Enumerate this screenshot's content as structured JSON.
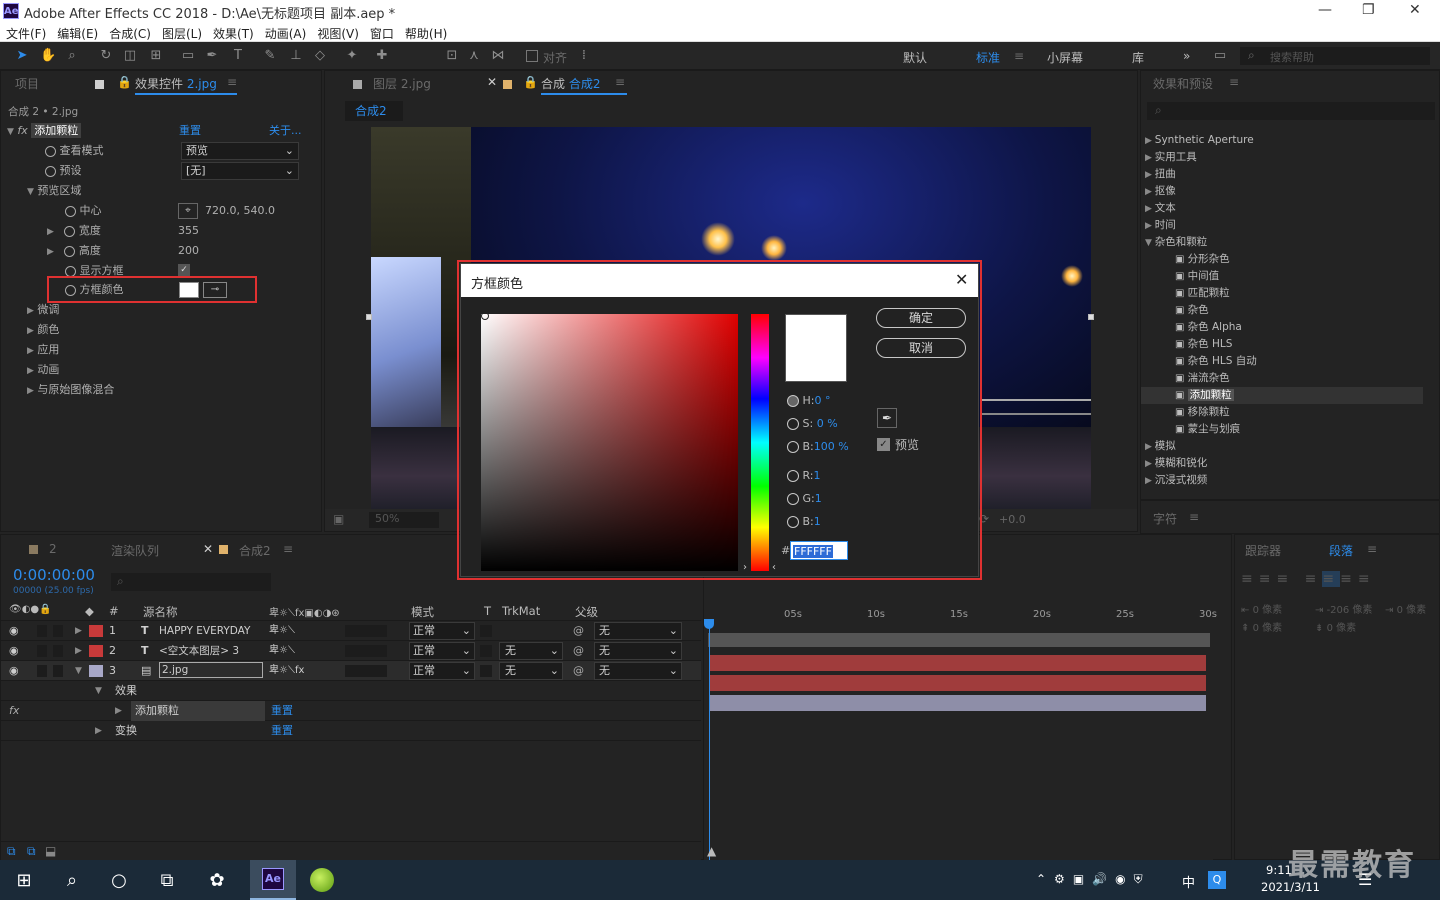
{
  "window": {
    "logo": "Ae",
    "title": "Adobe After Effects CC 2018 - D:\\Ae\\无标题项目 副本.aep *",
    "minimize": "—",
    "maximize": "❐",
    "close": "✕"
  },
  "menu": [
    "文件(F)",
    "编辑(E)",
    "合成(C)",
    "图层(L)",
    "效果(T)",
    "动画(A)",
    "视图(V)",
    "窗口",
    "帮助(H)"
  ],
  "toolbar": {
    "align_label": "对齐",
    "workspaces": [
      "默认",
      "标准",
      "小屏幕",
      "库"
    ],
    "more": "»",
    "search_placeholder": "搜索帮助"
  },
  "left_panel": {
    "tabs": [
      "项目",
      "效果控件 2.jpg"
    ],
    "tab_project": "项目",
    "tab_effect_prefix": "效果控件",
    "tab_effect_file": "2.jpg",
    "source": "合成 2 • 2.jpg",
    "effect": {
      "name": "添加颗粒",
      "reset": "重置",
      "about": "关于..."
    },
    "props": {
      "view_mode": {
        "label": "查看模式",
        "value": "预览"
      },
      "preset": {
        "label": "预设",
        "value": "[无]"
      },
      "preview_region": "预览区域",
      "center": {
        "label": "中心",
        "value": "720.0, 540.0"
      },
      "width": {
        "label": "宽度",
        "value": "355"
      },
      "height": {
        "label": "高度",
        "value": "200"
      },
      "show_box": {
        "label": "显示方框"
      },
      "box_color": {
        "label": "方框颜色"
      }
    },
    "groups": [
      "微调",
      "颜色",
      "应用",
      "动画",
      "与原始图像混合"
    ]
  },
  "viewer": {
    "tab_layer": "图层 2.jpg",
    "tab_comp_prefix": "合成",
    "tab_comp_name": "合成2",
    "breadcrumb": "合成2",
    "zoom": "50%",
    "exposure": "+0.0"
  },
  "effects_panel": {
    "title": "效果和预设",
    "items": [
      {
        "label": "Synthetic Aperture",
        "type": "cat"
      },
      {
        "label": "实用工具",
        "type": "cat"
      },
      {
        "label": "扭曲",
        "type": "cat"
      },
      {
        "label": "抠像",
        "type": "cat"
      },
      {
        "label": "文本",
        "type": "cat"
      },
      {
        "label": "时间",
        "type": "cat"
      },
      {
        "label": "杂色和颗粒",
        "type": "open"
      },
      {
        "label": "分形杂色",
        "type": "fx"
      },
      {
        "label": "中间值",
        "type": "fx"
      },
      {
        "label": "匹配颗粒",
        "type": "fx"
      },
      {
        "label": "杂色",
        "type": "fx"
      },
      {
        "label": "杂色 Alpha",
        "type": "fx"
      },
      {
        "label": "杂色 HLS",
        "type": "fx"
      },
      {
        "label": "杂色 HLS 自动",
        "type": "fx"
      },
      {
        "label": "湍流杂色",
        "type": "fx"
      },
      {
        "label": "添加颗粒",
        "type": "fx-sel"
      },
      {
        "label": "移除颗粒",
        "type": "fx"
      },
      {
        "label": "蒙尘与划痕",
        "type": "fx"
      },
      {
        "label": "模拟",
        "type": "cat"
      },
      {
        "label": "模糊和锐化",
        "type": "cat"
      },
      {
        "label": "沉浸式视频",
        "type": "cat"
      }
    ],
    "char_tab": "字符"
  },
  "right_lower": {
    "tracker": "跟踪器",
    "paragraph": "段落",
    "px0a": "0 像素",
    "px_neg": "-206 像素",
    "px0b": "0 像素",
    "px0c": "0 像素",
    "px0d": "0 像素"
  },
  "timeline": {
    "tabs": [
      "2",
      "渲染队列",
      "合成2"
    ],
    "timecode": "0:00:00:00",
    "fps": "00000 (25.00 fps)",
    "columns": {
      "num": "#",
      "source": "源名称",
      "mode": "模式",
      "t": "T",
      "trkmat": "TrkMat",
      "parent": "父级"
    },
    "layers": [
      {
        "n": "1",
        "icon": "T",
        "name": "HAPPY EVERYDAY",
        "mode": "正常",
        "trk": "",
        "parent": "无",
        "color": "#c83a3a"
      },
      {
        "n": "2",
        "icon": "T",
        "name": "<空文本图层> 3",
        "mode": "正常",
        "trk": "无",
        "parent": "无",
        "color": "#c83a3a"
      },
      {
        "n": "3",
        "icon": "img",
        "name": "2.jpg",
        "mode": "正常",
        "trk": "无",
        "parent": "无",
        "color": "#a8a8c8"
      }
    ],
    "effects_label": "效果",
    "fx_label": "添加颗粒",
    "reset": "重置",
    "transform_label": "变换",
    "ruler": [
      "05s",
      "10s",
      "15s",
      "20s",
      "25s",
      "30s"
    ]
  },
  "dialog": {
    "title": "方框颜色",
    "ok": "确定",
    "cancel": "取消",
    "h": {
      "label": "H:",
      "value": "0 °"
    },
    "s": {
      "label": "S:",
      "value": "0 %"
    },
    "b": {
      "label": "B:",
      "value": "100 %"
    },
    "r": {
      "label": "R:",
      "value": "1"
    },
    "g": {
      "label": "G:",
      "value": "1"
    },
    "bl": {
      "label": "B:",
      "value": "1"
    },
    "hash": "#",
    "hex": "FFFFFF",
    "preview_label": "预览"
  },
  "taskbar": {
    "time": "9:11",
    "date": "2021/3/11",
    "ime": "中",
    "watermark": "最需教育",
    "ae": "Ae"
  },
  "colors": {
    "accent": "#2d8ceb",
    "highlight": "#e03131",
    "bg": "#232323",
    "layer_red": "#c83a3a",
    "layer_lilac": "#a8a8c8"
  }
}
